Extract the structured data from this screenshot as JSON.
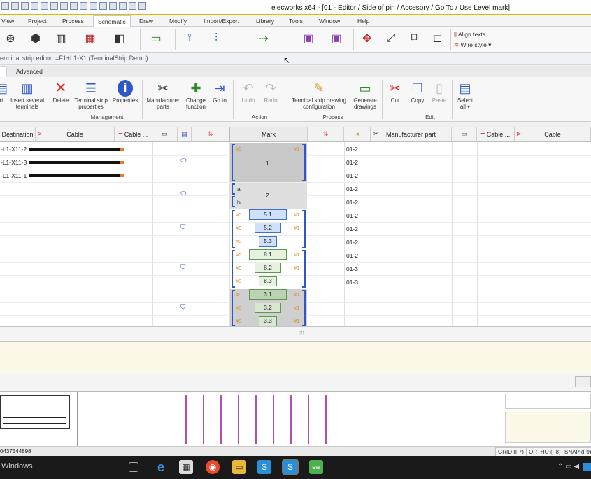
{
  "window": {
    "title": "elecworks x64 - [01 - Editor /  Side of pin / Accesory / Go To /  Use Level mark]"
  },
  "menu": [
    "View",
    "Project",
    "Process",
    "Schematic",
    "Draw",
    "Modify",
    "Import/Export",
    "Library",
    "Tools",
    "Window",
    "Help"
  ],
  "ribbon": {
    "align_texts": "Align texts",
    "wire_style": "Wire style"
  },
  "panel": {
    "title": "erminal strip editor: =F1+L1-X1 (TerminalStrip Demo)"
  },
  "subtabs": [
    "Advanced"
  ],
  "toolbar": {
    "buttons": [
      {
        "label": "rt",
        "icon": "insert-icon"
      },
      {
        "label": "Insert several terminals",
        "icon": "insert-several-icon"
      },
      {
        "label": "Delete",
        "icon": "delete-icon"
      },
      {
        "label": "Terminal strip properties",
        "icon": "strip-properties-icon"
      },
      {
        "label": "Properties",
        "icon": "info-icon"
      },
      {
        "label": "Manufacturer parts",
        "icon": "tools-icon"
      },
      {
        "label": "Change function",
        "icon": "change-function-icon"
      },
      {
        "label": "Go to",
        "icon": "goto-icon"
      },
      {
        "label": "Undo",
        "icon": "undo-icon"
      },
      {
        "label": "Redo",
        "icon": "redo-icon"
      },
      {
        "label": "Terminal strip drawing configuration",
        "icon": "drawing-config-icon"
      },
      {
        "label": "Generate drawings",
        "icon": "generate-icon"
      },
      {
        "label": "Cut",
        "icon": "scissors-icon"
      },
      {
        "label": "Copy",
        "icon": "copy-icon"
      },
      {
        "label": "Paste",
        "icon": "paste-icon"
      },
      {
        "label": "Select all",
        "icon": "select-all-icon"
      }
    ],
    "groups": [
      "Management",
      "Action",
      "Process",
      "Edit"
    ]
  },
  "grid": {
    "headers": [
      "Destination",
      "Cable",
      "Cable ...",
      "Mark",
      "Manufacturer part",
      "Cable ...",
      "Cable"
    ],
    "destinations": [
      "-L1-X11-2",
      "-L1-X11-3",
      "-L1-X11-1"
    ],
    "marks": {
      "group1": "1",
      "a": "a",
      "b": "b",
      "group2": "2",
      "hash0": "#0",
      "hash1": "#1",
      "blue": [
        "5.1",
        "5.2",
        "5.3"
      ],
      "green1": [
        "8.1",
        "8.2",
        "8.3"
      ],
      "green2": [
        "3.1",
        "3.2",
        "3.3"
      ]
    },
    "levels": [
      "01-2",
      "01-2",
      "01-2",
      "01-2",
      "01-2",
      "01-2",
      "01-2",
      "01-2",
      "01-2",
      "01-3",
      "01-3"
    ]
  },
  "status": {
    "coord": "0437544898",
    "grid": "GRID (F7)",
    "ortho": "ORTHO (F8)",
    "snap": "SNAP (F9)"
  },
  "taskbar": {
    "label": "Windows"
  },
  "colors": {
    "accent": "#e8b400",
    "bracket": "#2f57c9",
    "blue_mark": "#cfe0f8",
    "green_mark": "#e6f2df",
    "wire_end": "#f07b2a"
  }
}
